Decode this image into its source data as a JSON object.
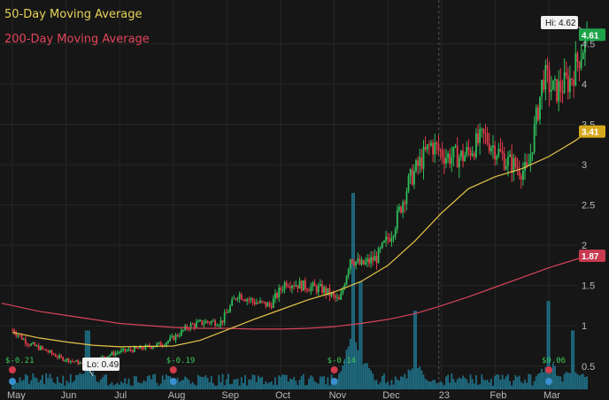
{
  "legend": {
    "ma50": "50-Day Moving Average",
    "ma200": "200-Day Moving Average"
  },
  "colors": {
    "background": "#161616",
    "grid": "#262626",
    "up": "#2fbd5a",
    "down": "#e23b4a",
    "volume": "#1f6f86",
    "ma50": "#e8c44a",
    "ma200": "#d8455a",
    "axis_text": "#b8b8b8"
  },
  "chart_data": {
    "type": "candlestick",
    "x_ticks": [
      "May",
      "Jun",
      "Jul",
      "Aug",
      "Sep",
      "Oct",
      "Nov",
      "Dec",
      "23",
      "Feb",
      "Mar"
    ],
    "y_ticks": [
      "0.5",
      "1",
      "1.5",
      "2",
      "2.5",
      "3",
      "3.5",
      "4",
      "4.5"
    ],
    "ylim": [
      0.3,
      4.8
    ],
    "grid": true,
    "flags": {
      "hi_label": "Hi: 4.62",
      "hi_value": 4.62,
      "lo_label": "Lo: 0.49",
      "lo_value": 0.49,
      "last_price": "4.61",
      "last_price_value": 4.61,
      "ma50_badge": "3.41",
      "ma50_value": 3.41,
      "ma200_badge": "1.87",
      "ma200_value": 1.87
    },
    "earnings": [
      {
        "month_index": 0,
        "label": "$-0.21"
      },
      {
        "month_index": 3,
        "label": "$-0.19"
      },
      {
        "month_index": 6,
        "label": "$-0.14"
      },
      {
        "month_index": 10,
        "label": "$0.06"
      }
    ],
    "price_anchors": [
      [
        0,
        0.95
      ],
      [
        0.3,
        0.78
      ],
      [
        0.6,
        0.7
      ],
      [
        0.9,
        0.6
      ],
      [
        1.2,
        0.55
      ],
      [
        1.4,
        0.5
      ],
      [
        1.7,
        0.62
      ],
      [
        2.0,
        0.68
      ],
      [
        2.4,
        0.72
      ],
      [
        2.8,
        0.78
      ],
      [
        3.0,
        0.85
      ],
      [
        3.3,
        1.0
      ],
      [
        3.6,
        1.05
      ],
      [
        3.9,
        1.05
      ],
      [
        4.2,
        1.4
      ],
      [
        4.5,
        1.3
      ],
      [
        4.8,
        1.25
      ],
      [
        5.1,
        1.55
      ],
      [
        5.4,
        1.5
      ],
      [
        5.8,
        1.45
      ],
      [
        6.1,
        1.3
      ],
      [
        6.3,
        1.85
      ],
      [
        6.5,
        1.75
      ],
      [
        6.8,
        1.85
      ],
      [
        7.1,
        2.2
      ],
      [
        7.4,
        2.8
      ],
      [
        7.8,
        3.25
      ],
      [
        8.1,
        3.1
      ],
      [
        8.4,
        3.1
      ],
      [
        8.8,
        3.35
      ],
      [
        9.2,
        3.05
      ],
      [
        9.6,
        2.9
      ],
      [
        9.75,
        3.5
      ],
      [
        9.9,
        4.1
      ],
      [
        10.1,
        3.9
      ],
      [
        10.4,
        4.05
      ],
      [
        10.6,
        4.4
      ],
      [
        10.72,
        4.61
      ]
    ],
    "ma50": [
      [
        0,
        0.92
      ],
      [
        0.5,
        0.85
      ],
      [
        1.0,
        0.8
      ],
      [
        1.5,
        0.76
      ],
      [
        2.0,
        0.74
      ],
      [
        3.0,
        0.75
      ],
      [
        3.5,
        0.82
      ],
      [
        4.0,
        0.95
      ],
      [
        4.5,
        1.08
      ],
      [
        5.0,
        1.2
      ],
      [
        5.5,
        1.32
      ],
      [
        6.0,
        1.42
      ],
      [
        6.5,
        1.55
      ],
      [
        7.0,
        1.75
      ],
      [
        7.5,
        2.05
      ],
      [
        8.0,
        2.4
      ],
      [
        8.5,
        2.7
      ],
      [
        9.0,
        2.85
      ],
      [
        9.5,
        2.95
      ],
      [
        10.0,
        3.1
      ],
      [
        10.5,
        3.3
      ],
      [
        10.72,
        3.41
      ]
    ],
    "ma200": [
      [
        -0.2,
        1.28
      ],
      [
        0.5,
        1.18
      ],
      [
        1.0,
        1.13
      ],
      [
        1.5,
        1.08
      ],
      [
        2.0,
        1.03
      ],
      [
        3.0,
        0.98
      ],
      [
        3.5,
        0.97
      ],
      [
        4.0,
        0.97
      ],
      [
        4.5,
        0.96
      ],
      [
        5.0,
        0.96
      ],
      [
        5.5,
        0.97
      ],
      [
        6.0,
        0.99
      ],
      [
        6.5,
        1.03
      ],
      [
        7.0,
        1.08
      ],
      [
        7.5,
        1.15
      ],
      [
        8.0,
        1.25
      ],
      [
        8.5,
        1.36
      ],
      [
        9.0,
        1.48
      ],
      [
        9.5,
        1.6
      ],
      [
        10.0,
        1.72
      ],
      [
        10.72,
        1.87
      ]
    ],
    "volume_spikes": [
      {
        "x": 1.4,
        "h": 0.3
      },
      {
        "x": 6.35,
        "h": 1.0
      },
      {
        "x": 6.5,
        "h": 0.55
      },
      {
        "x": 7.5,
        "h": 0.4
      },
      {
        "x": 10.0,
        "h": 0.45
      },
      {
        "x": 10.45,
        "h": 0.3
      }
    ]
  }
}
